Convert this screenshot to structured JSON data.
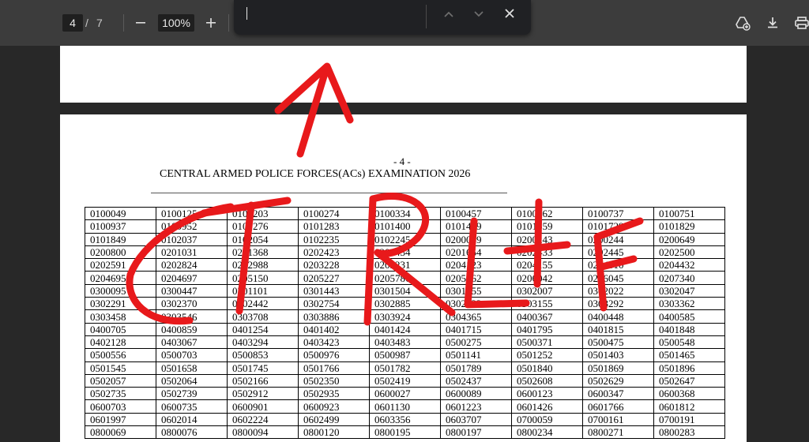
{
  "toolbar": {
    "current_page": "4",
    "separator": "/",
    "total_pages": "7",
    "zoom": "100%"
  },
  "find": {
    "value": "",
    "placeholder": ""
  },
  "document": {
    "page_number_label": "- 4 -",
    "title": "CENTRAL ARMED POLICE FORCES(ACs) EXAMINATION 2026"
  },
  "rows": [
    [
      "0100049",
      "0100125",
      "0100203",
      "0100274",
      "0100334",
      "0100457",
      "0100662",
      "0100737",
      "0100751"
    ],
    [
      "0100937",
      "0100952",
      "0101276",
      "0101283",
      "0101400",
      "0101499",
      "0101559",
      "0101729",
      "0101829"
    ],
    [
      "0101849",
      "0102037",
      "0102054",
      "0102235",
      "0102245",
      "0200069",
      "0200243",
      "0200244",
      "0200649"
    ],
    [
      "0200800",
      "0201031",
      "0201368",
      "0202423",
      "0202434",
      "0201654",
      "0202433",
      "0202445",
      "0202500"
    ],
    [
      "0202591",
      "0202824",
      "0202988",
      "0203228",
      "0203231",
      "0204123",
      "0204155",
      "0204310",
      "0204432"
    ],
    [
      "0204695",
      "0204697",
      "0205150",
      "0205227",
      "0205786",
      "0205862",
      "0206042",
      "0206045",
      "0207340"
    ],
    [
      "0300095",
      "0300447",
      "0301101",
      "0301443",
      "0301504",
      "0301555",
      "0302007",
      "0302022",
      "0302047"
    ],
    [
      "0302291",
      "0302370",
      "0302442",
      "0302754",
      "0302885",
      "0302933",
      "0303155",
      "0303292",
      "0303362"
    ],
    [
      "0303458",
      "0303546",
      "0303708",
      "0303886",
      "0303924",
      "0304365",
      "0400367",
      "0400448",
      "0400585"
    ],
    [
      "0400705",
      "0400859",
      "0401254",
      "0401402",
      "0401424",
      "0401715",
      "0401795",
      "0401815",
      "0401848"
    ],
    [
      "0402128",
      "0403067",
      "0403294",
      "0403423",
      "0403483",
      "0500275",
      "0500371",
      "0500475",
      "0500548"
    ],
    [
      "0500556",
      "0500703",
      "0500853",
      "0500976",
      "0500987",
      "0501141",
      "0501252",
      "0501403",
      "0501465"
    ],
    [
      "0501545",
      "0501658",
      "0501745",
      "0501766",
      "0501782",
      "0501789",
      "0501840",
      "0501869",
      "0501896"
    ],
    [
      "0502057",
      "0502064",
      "0502166",
      "0502350",
      "0502419",
      "0502437",
      "0502608",
      "0502629",
      "0502647"
    ],
    [
      "0502735",
      "0502739",
      "0502912",
      "0502935",
      "0600027",
      "0600089",
      "0600123",
      "0600347",
      "0600368"
    ],
    [
      "0600703",
      "0600735",
      "0600901",
      "0600923",
      "0601130",
      "0601223",
      "0601426",
      "0601766",
      "0601812"
    ],
    [
      "0601997",
      "0602014",
      "0602224",
      "0602499",
      "0603356",
      "0603707",
      "0700059",
      "0700161",
      "0700191"
    ],
    [
      "0800069",
      "0800076",
      "0800094",
      "0800120",
      "0800195",
      "0800197",
      "0800234",
      "0800271",
      "0800283"
    ]
  ],
  "colors": {
    "toolbar_bg": "#3c3c3c",
    "viewer_bg": "#282828",
    "findbar_bg": "#202124",
    "annotation_red": "#e8191b"
  },
  "icons": [
    "minus-icon",
    "plus-icon",
    "chevron-up-icon",
    "chevron-down-icon",
    "close-icon",
    "drive-add-icon",
    "download-icon",
    "print-icon"
  ]
}
